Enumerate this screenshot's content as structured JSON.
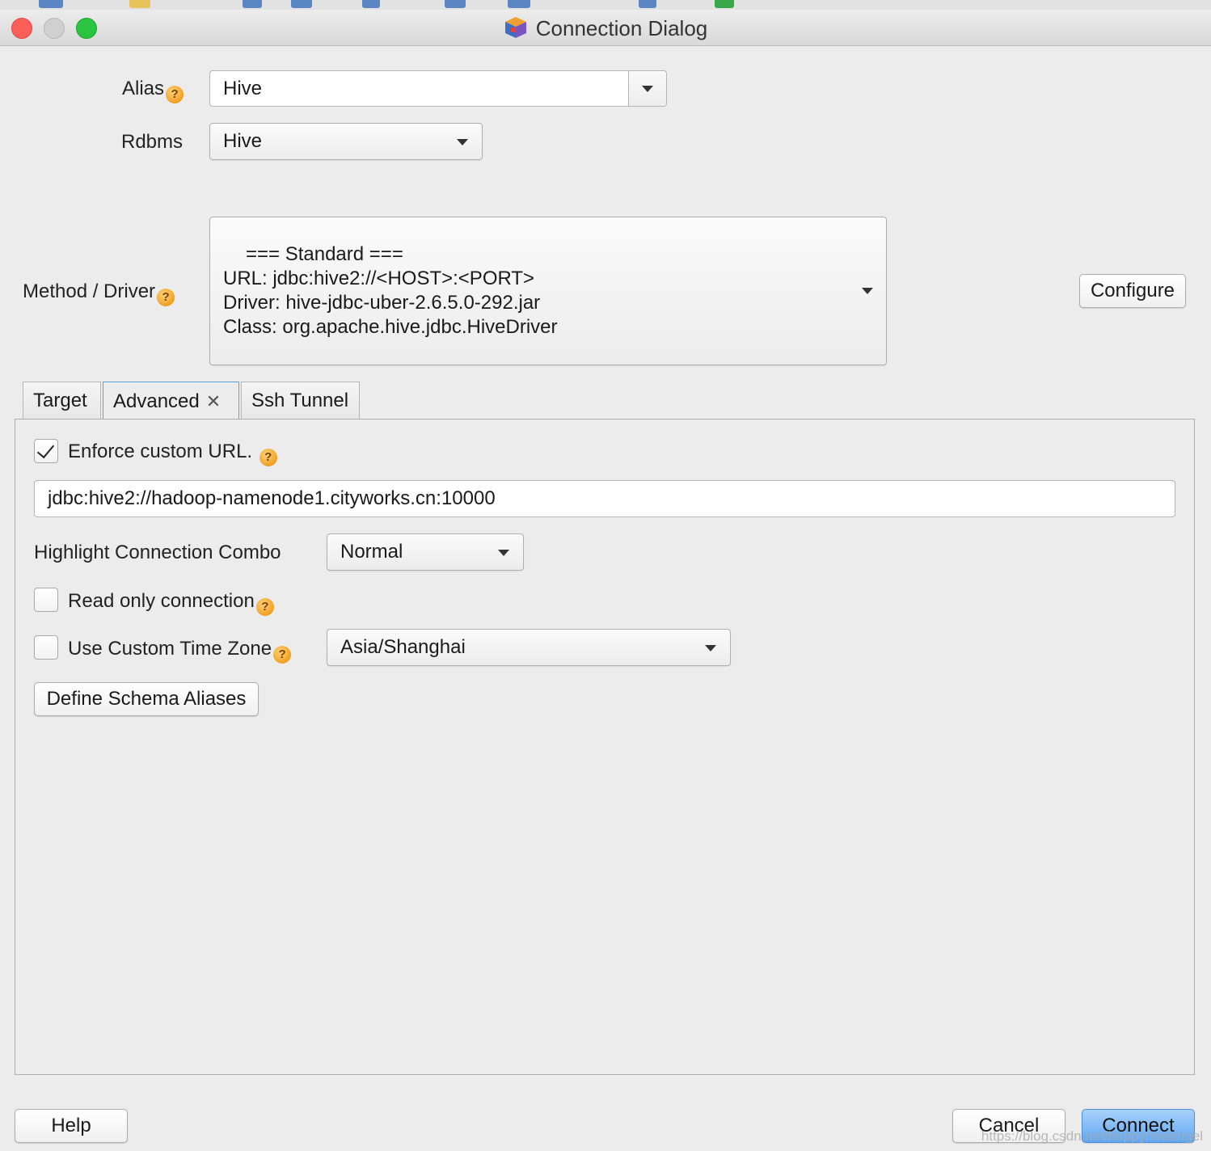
{
  "window": {
    "title": "Connection Dialog"
  },
  "alias": {
    "label": "Alias",
    "value": "Hive"
  },
  "rdbms": {
    "label": "Rdbms",
    "value": "Hive"
  },
  "driver": {
    "label": "Method / Driver",
    "line1": "=== Standard ===",
    "line2": "URL: jdbc:hive2://<HOST>:<PORT>",
    "line3": "Driver: hive-jdbc-uber-2.6.5.0-292.jar",
    "line4": "Class: org.apache.hive.jdbc.HiveDriver",
    "configure_label": "Configure"
  },
  "tabs": [
    {
      "label": "Target"
    },
    {
      "label": "Advanced",
      "close": "✕"
    },
    {
      "label": "Ssh Tunnel"
    }
  ],
  "advanced": {
    "enforce_url": {
      "label": "Enforce custom URL.",
      "checked": true
    },
    "url_value": "jdbc:hive2://hadoop-namenode1.cityworks.cn:10000",
    "highlight": {
      "label": "Highlight Connection Combo",
      "value": "Normal"
    },
    "read_only": {
      "label": "Read only connection",
      "checked": false
    },
    "timezone": {
      "label": "Use Custom Time Zone",
      "checked": false,
      "value": "Asia/Shanghai"
    },
    "schema_aliases_label": "Define Schema Aliases"
  },
  "footer": {
    "help": "Help",
    "cancel": "Cancel",
    "connect": "Connect"
  },
  "watermark": "https://blog.csdn.net/happyfreeangel",
  "icons": {
    "help": "question-mark",
    "dropdown": "chevron-down",
    "check": "checkmark"
  },
  "colors": {
    "accent": "#5fa6f2",
    "help_badge": "#f0a020",
    "close": "#fc5f57",
    "maximize": "#29c440"
  }
}
